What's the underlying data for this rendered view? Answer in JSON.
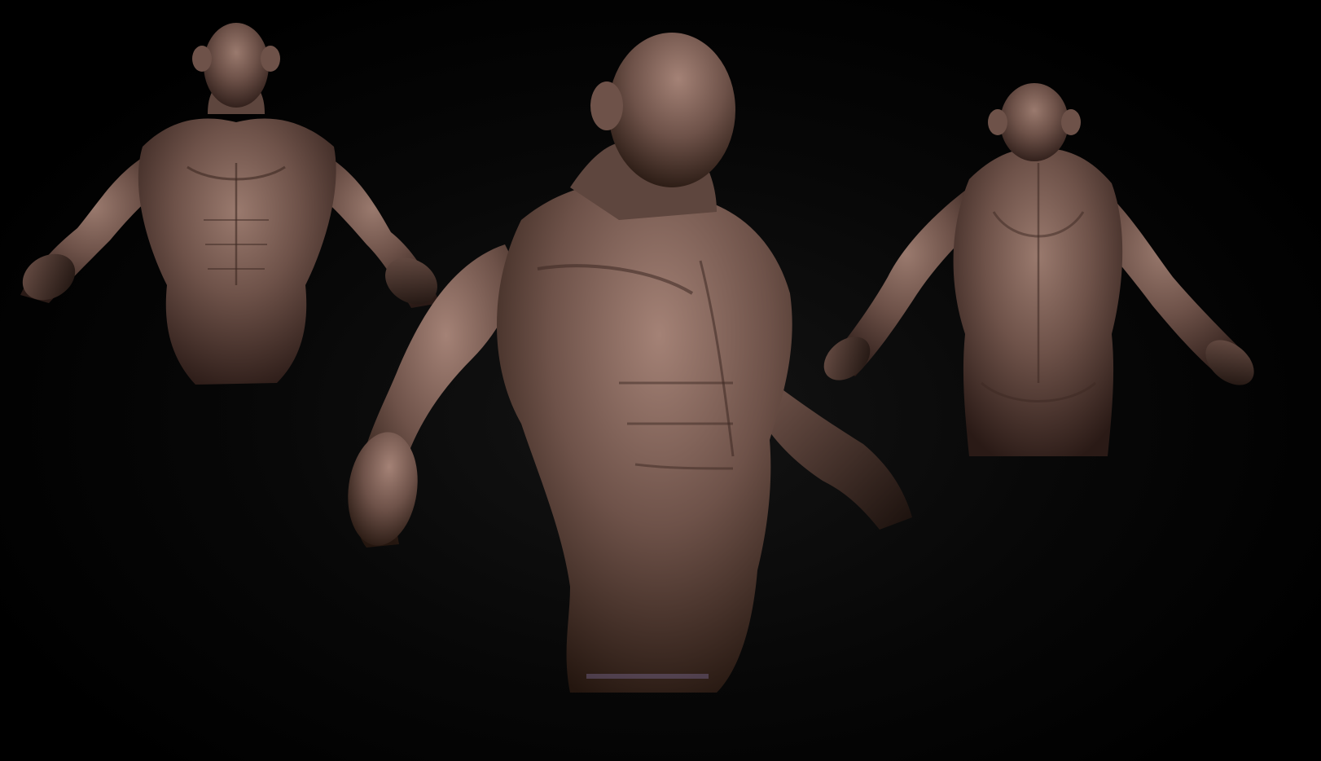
{
  "scene": {
    "background_color": "#000000",
    "skin_color": "#6e5249",
    "skin_highlight": "#9a7a6e",
    "skin_shadow": "#2a1a16",
    "views": [
      {
        "view": "front"
      },
      {
        "view": "three-quarter"
      },
      {
        "view": "back"
      }
    ]
  }
}
